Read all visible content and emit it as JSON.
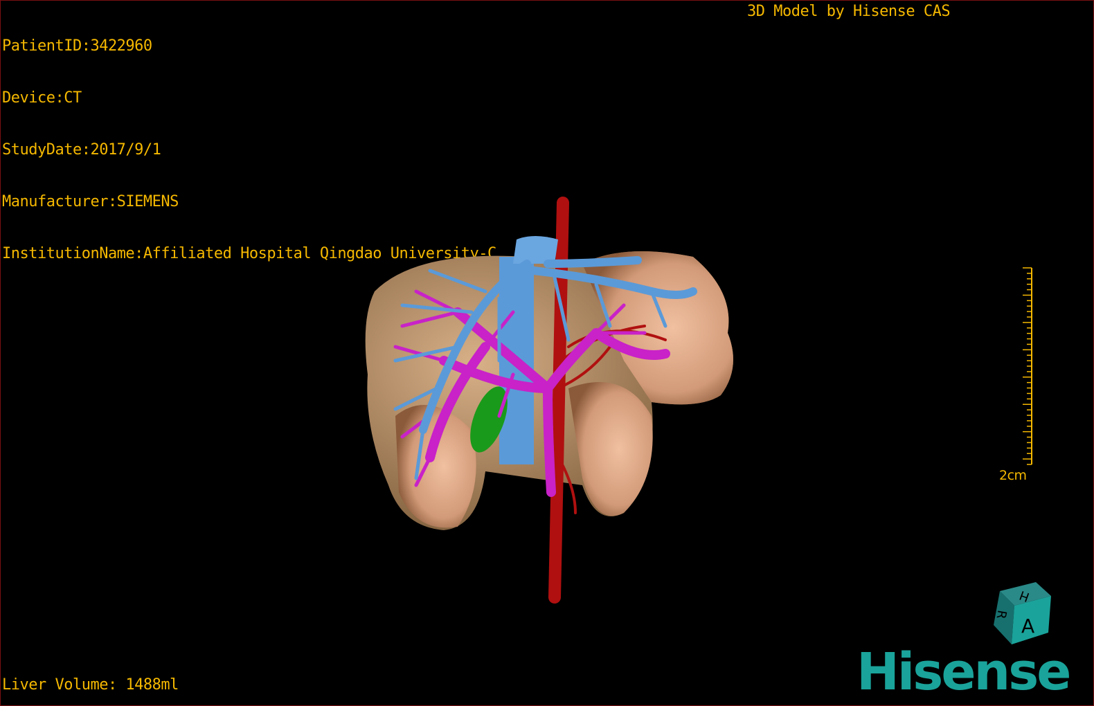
{
  "patient_info": [
    "PatientID:3422960",
    "Device:CT",
    "StudyDate:2017/9/1",
    "Manufacturer:SIEMENS",
    "InstitutionName:Affiliated Hospital Qingdao University-C"
  ],
  "title": "3D Model by Hisense CAS",
  "liver_volume": "Liver Volume: 1488ml",
  "scale_bar": {
    "label": "2cm"
  },
  "orientation_cube": {
    "faces": [
      "H",
      "R",
      "A"
    ]
  },
  "logo": "Hisense",
  "colors": {
    "text": "#f5b800",
    "liver": "#d9a27e",
    "hepatic_vein": "#5b9ad8",
    "portal_vein": "#c822c8",
    "artery": "#b01010",
    "gallbladder": "#1a9a1a",
    "logo": "#1aa39a"
  }
}
